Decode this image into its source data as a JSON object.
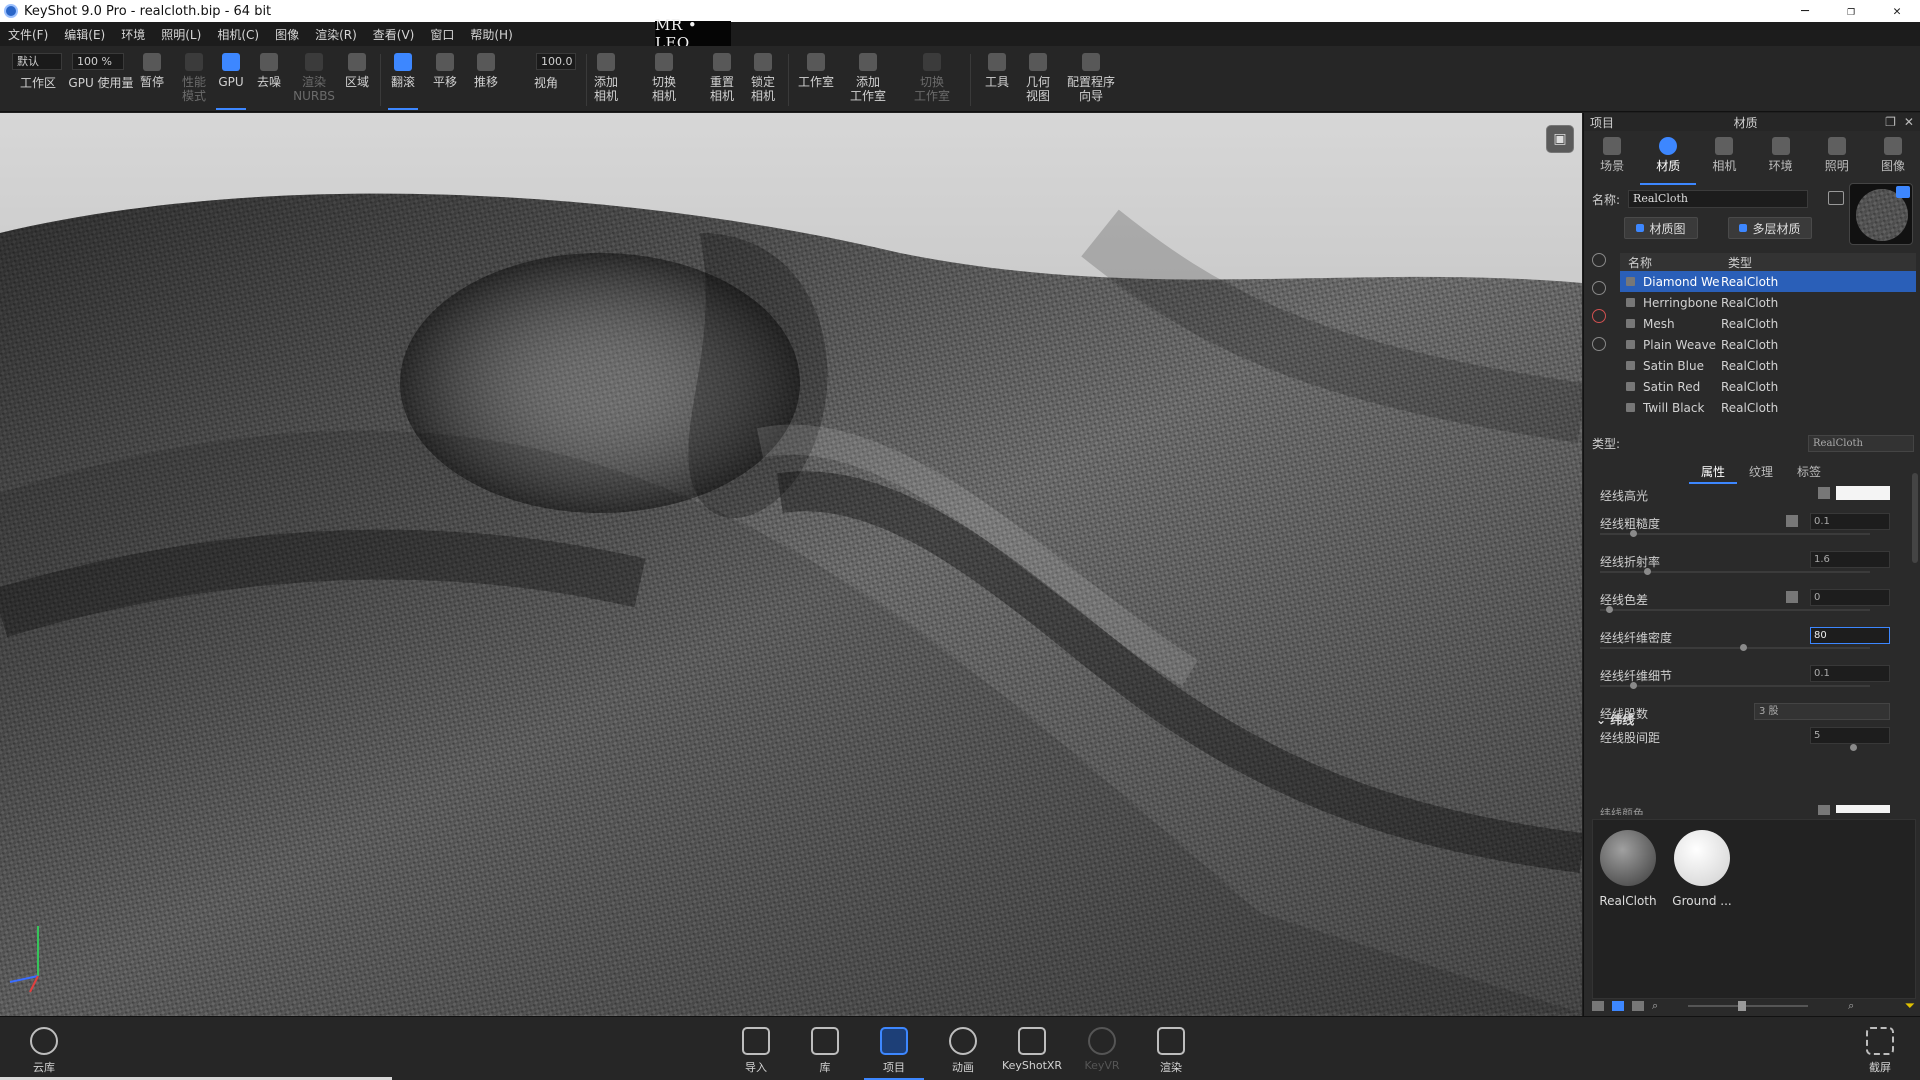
{
  "window": {
    "title": "KeyShot 9.0 Pro  - realcloth.bip  - 64 bit",
    "controls": [
      "─",
      "❐",
      "✕"
    ]
  },
  "watermark": "MR • LEO",
  "menu": [
    "文件(F)",
    "编辑(E)",
    "环境",
    "照明(L)",
    "相机(C)",
    "图像",
    "渲染(R)",
    "查看(V)",
    "窗口",
    "帮助(H)"
  ],
  "toolbar": {
    "preset": "默认",
    "zoom": "100 %",
    "fov_value": "100.0",
    "buttons": {
      "workspace": "工作区",
      "gpu_usage": "GPU 使用量",
      "pause": "暂停",
      "perf_mode": "性能\n模式",
      "gpu": "GPU",
      "denoise": "去噪",
      "render_nurbs": "渲染\nNURBS",
      "region": "区域",
      "tumble": "翻滚",
      "pan": "平移",
      "dolly": "推移",
      "perspective": "视角",
      "add_camera": "添加\n相机",
      "switch_camera": "切换\n相机",
      "reset_camera": "重置\n相机",
      "lock_camera": "锁定\n相机",
      "studio": "工作室",
      "add_studio": "添加\n工作室",
      "switch_studio": "切换\n工作室",
      "tools": "工具",
      "geometry_view": "几何\n视图",
      "config_wizard": "配置程序\n向导"
    }
  },
  "panel": {
    "left_title": "项目",
    "center_title": "材质",
    "tabs": [
      "场景",
      "材质",
      "相机",
      "环境",
      "照明",
      "图像"
    ],
    "active_tab": "材质",
    "name_label": "名称:",
    "name_value": "RealCloth",
    "btn_material_graph": "材质图",
    "btn_multi_material": "多层材质",
    "table_headers": [
      "名称",
      "类型"
    ],
    "materials": [
      {
        "name": "Diamond We",
        "type": "RealCloth",
        "selected": true
      },
      {
        "name": "Herringbone",
        "type": "RealCloth",
        "selected": false
      },
      {
        "name": "Mesh",
        "type": "RealCloth",
        "selected": false
      },
      {
        "name": "Plain Weave",
        "type": "RealCloth",
        "selected": false
      },
      {
        "name": "Satin Blue",
        "type": "RealCloth",
        "selected": false
      },
      {
        "name": "Satin Red",
        "type": "RealCloth",
        "selected": false
      },
      {
        "name": "Twill Black",
        "type": "RealCloth",
        "selected": false
      }
    ],
    "type_label": "类型:",
    "type_value": "RealCloth",
    "prop_tabs": [
      "属性",
      "纹理",
      "标签"
    ],
    "props": [
      {
        "label": "经线高光",
        "value": "",
        "kind": "swatch"
      },
      {
        "label": "经线粗糙度",
        "value": "0.1",
        "kind": "value"
      },
      {
        "label": "经线折射率",
        "value": "1.6",
        "kind": "value"
      },
      {
        "label": "经线色差",
        "value": "0",
        "kind": "value"
      },
      {
        "label": "经线纤维密度",
        "value": "80",
        "kind": "value-focus"
      },
      {
        "label": "经线纤维细节",
        "value": "0.1",
        "kind": "value"
      },
      {
        "label": "经线股数",
        "value": "3 股",
        "kind": "dropdown"
      },
      {
        "label": "经线股间距",
        "value": "5",
        "kind": "value"
      }
    ],
    "section_weft": "纬线",
    "weft_partial_label": "纬线颜色",
    "library_items": [
      {
        "label": "RealCloth",
        "color": "#7a7a7a"
      },
      {
        "label": "Ground ...",
        "color": "#f2f2f2"
      }
    ]
  },
  "dock": {
    "cloud": "云库",
    "items": [
      {
        "label": "导入",
        "state": "normal"
      },
      {
        "label": "库",
        "state": "normal"
      },
      {
        "label": "项目",
        "state": "active"
      },
      {
        "label": "动画",
        "state": "normal"
      },
      {
        "label": "KeyShotXR",
        "state": "normal"
      },
      {
        "label": "KeyVR",
        "state": "dim"
      },
      {
        "label": "渲染",
        "state": "normal"
      }
    ],
    "screenshot": "截屏"
  },
  "colors": {
    "accent": "#3d87ff",
    "selection": "#2a5fb8"
  }
}
